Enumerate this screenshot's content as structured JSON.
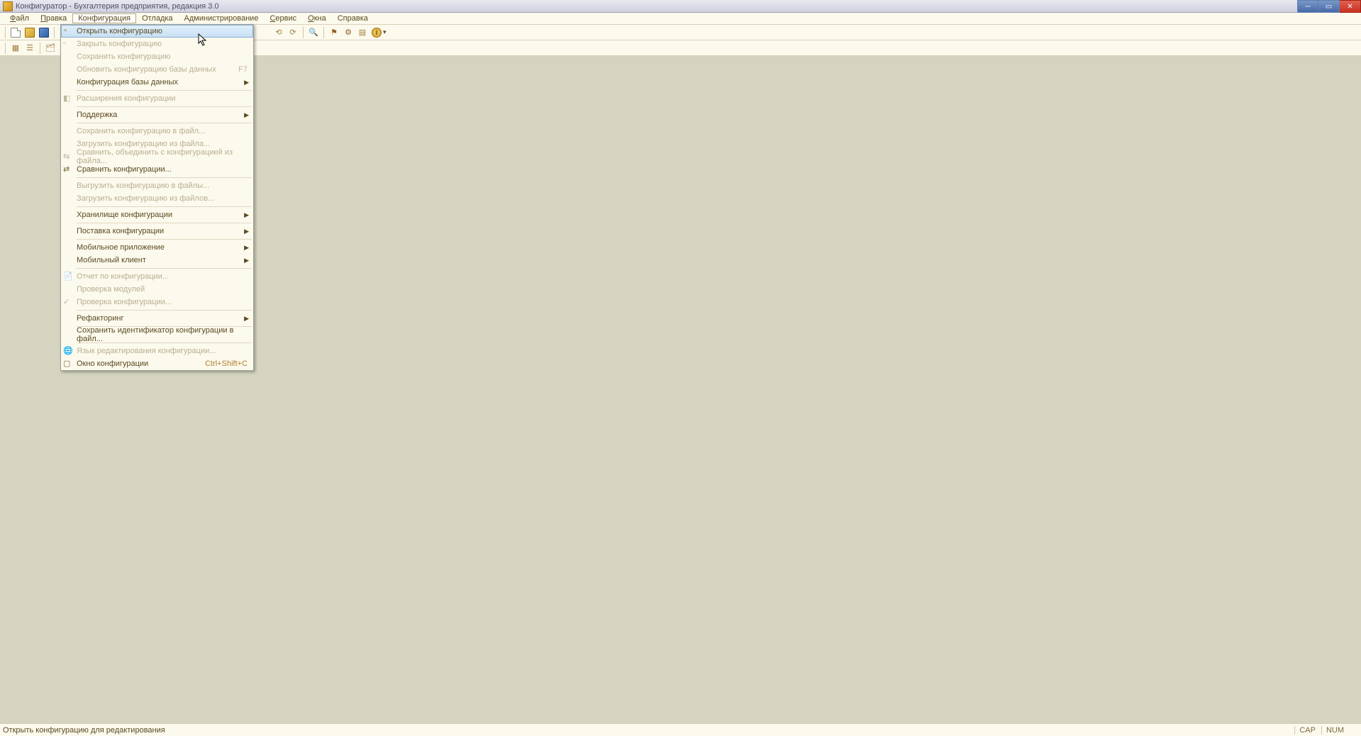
{
  "titlebar": {
    "title": "Конфигуратор - Бухгалтерия предприятия, редакция 3.0"
  },
  "menubar": {
    "items": [
      {
        "label": "Файл",
        "underline_idx": 0
      },
      {
        "label": "Правка",
        "underline_idx": 0
      },
      {
        "label": "Конфигурация",
        "underline_idx": -1,
        "active": true
      },
      {
        "label": "Отладка",
        "underline_idx": -1
      },
      {
        "label": "Администрирование",
        "underline_idx": -1
      },
      {
        "label": "Сервис",
        "underline_idx": 0
      },
      {
        "label": "Окна",
        "underline_idx": 0
      },
      {
        "label": "Справка",
        "underline_idx": -1
      }
    ]
  },
  "dropdown": {
    "items": [
      {
        "type": "item",
        "label": "Открыть конфигурацию",
        "enabled": true,
        "highlighted": true,
        "icon": "doc"
      },
      {
        "type": "item",
        "label": "Закрыть конфигурацию",
        "enabled": false,
        "icon": "doc-x"
      },
      {
        "type": "item",
        "label": "Сохранить конфигурацию",
        "enabled": false
      },
      {
        "type": "item",
        "label": "Обновить конфигурацию базы данных",
        "enabled": false,
        "shortcut": "F7"
      },
      {
        "type": "item",
        "label": "Конфигурация базы данных",
        "enabled": true,
        "submenu": true
      },
      {
        "type": "sep"
      },
      {
        "type": "item",
        "label": "Расширения конфигурации",
        "enabled": false,
        "icon": "ext"
      },
      {
        "type": "sep"
      },
      {
        "type": "item",
        "label": "Поддержка",
        "enabled": true,
        "submenu": true
      },
      {
        "type": "sep"
      },
      {
        "type": "item",
        "label": "Сохранить конфигурацию в файл...",
        "enabled": false
      },
      {
        "type": "item",
        "label": "Загрузить конфигурацию из файла...",
        "enabled": false
      },
      {
        "type": "item",
        "label": "Сравнить, объединить с конфигурацией из файла...",
        "enabled": false,
        "icon": "merge"
      },
      {
        "type": "item",
        "label": "Сравнить конфигурации...",
        "enabled": true,
        "icon": "compare"
      },
      {
        "type": "sep"
      },
      {
        "type": "item",
        "label": "Выгрузить конфигурацию в файлы...",
        "enabled": false
      },
      {
        "type": "item",
        "label": "Загрузить конфигурацию из файлов...",
        "enabled": false
      },
      {
        "type": "sep"
      },
      {
        "type": "item",
        "label": "Хранилище конфигурации",
        "enabled": true,
        "submenu": true
      },
      {
        "type": "sep"
      },
      {
        "type": "item",
        "label": "Поставка конфигурации",
        "enabled": true,
        "submenu": true
      },
      {
        "type": "sep"
      },
      {
        "type": "item",
        "label": "Мобильное приложение",
        "enabled": true,
        "submenu": true
      },
      {
        "type": "item",
        "label": "Мобильный клиент",
        "enabled": true,
        "submenu": true
      },
      {
        "type": "sep"
      },
      {
        "type": "item",
        "label": "Отчет по конфигурации...",
        "enabled": false,
        "icon": "report"
      },
      {
        "type": "item",
        "label": "Проверка модулей",
        "enabled": false
      },
      {
        "type": "item",
        "label": "Проверка конфигурации...",
        "enabled": false,
        "icon": "check"
      },
      {
        "type": "sep"
      },
      {
        "type": "item",
        "label": "Рефакторинг",
        "enabled": true,
        "submenu": true
      },
      {
        "type": "sep"
      },
      {
        "type": "item",
        "label": "Сохранить идентификатор конфигурации в файл...",
        "enabled": true
      },
      {
        "type": "sep"
      },
      {
        "type": "item",
        "label": "Язык редактирования конфигурации...",
        "enabled": false,
        "icon": "lang"
      },
      {
        "type": "item",
        "label": "Окно конфигурации",
        "enabled": true,
        "shortcut": "Ctrl+Shift+C",
        "icon": "window"
      }
    ]
  },
  "statusbar": {
    "text": "Открыть конфигурацию для редактирования",
    "cap": "CAP",
    "num": "NUM"
  }
}
